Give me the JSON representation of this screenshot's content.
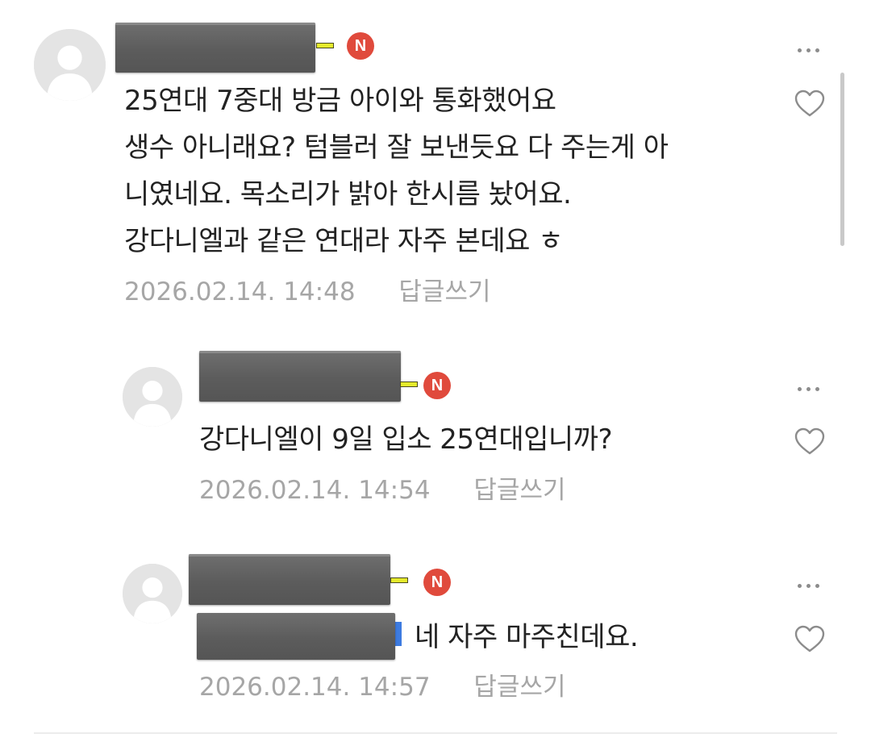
{
  "comments": [
    {
      "badge": "N",
      "body": "25연대 7중대 방금 아이와 통화했어요\n생수 아니래요? 텀블러 잘 보낸듯요 다 주는게 아\n니였네요. 목소리가 밝아 한시름 놨어요.\n강다니엘과 같은 연대라 자주 본데요 ㅎ",
      "date": "2026.02.14. 14:48",
      "reply_label": "답글쓰기"
    },
    {
      "badge": "N",
      "body": "강다니엘이 9일 입소 25연대입니까?",
      "date": "2026.02.14. 14:54",
      "reply_label": "답글쓰기"
    },
    {
      "badge": "N",
      "body": "네 자주 마주친데요.",
      "date": "2026.02.14. 14:57",
      "reply_label": "답글쓰기"
    }
  ],
  "colors": {
    "badge": "#e04a3c",
    "mention": "#3d7be0",
    "meta_text": "#a6a6a6",
    "body_text": "#222222"
  }
}
